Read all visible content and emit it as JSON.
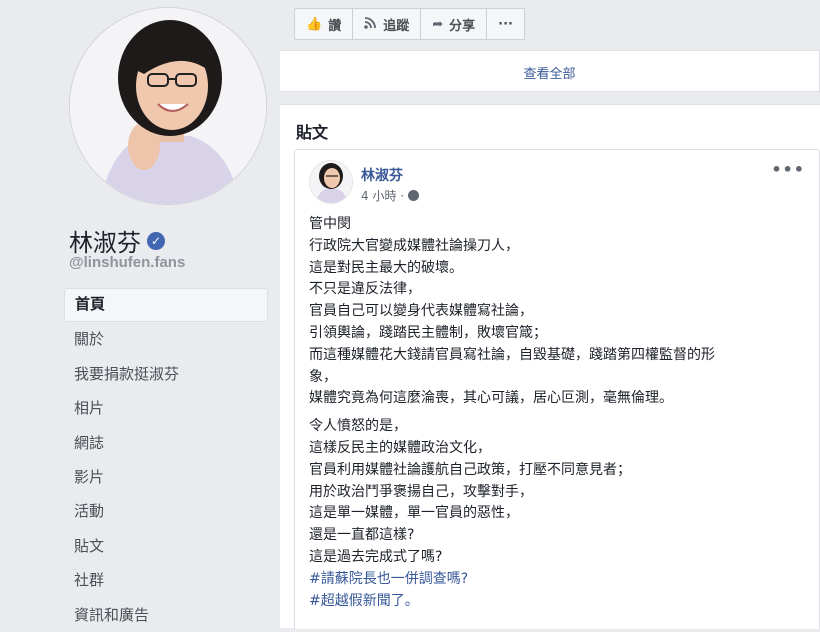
{
  "page": {
    "name": "林淑芬",
    "handle": "@linshufen.fans"
  },
  "nav": [
    {
      "label": "首頁",
      "active": true
    },
    {
      "label": "關於"
    },
    {
      "label": "我要捐款挺淑芬"
    },
    {
      "label": "相片"
    },
    {
      "label": "網誌"
    },
    {
      "label": "影片"
    },
    {
      "label": "活動"
    },
    {
      "label": "貼文"
    },
    {
      "label": "社群"
    },
    {
      "label": "資訊和廣告"
    }
  ],
  "actions": {
    "like": "讚",
    "follow": "追蹤",
    "share": "分享",
    "more": "···"
  },
  "see_all": "查看全部",
  "posts": {
    "title": "貼文",
    "post": {
      "author": "林淑芬",
      "time": "4 小時 ·",
      "paragraph1": [
        "管中閔",
        "行政院大官變成媒體社論操刀人，",
        "這是對民主最大的破壞。",
        "不只是違反法律，",
        "官員自己可以變身代表媒體寫社論，",
        "引領輿論，踐踏民主體制，敗壞官箴；",
        "而這種媒體花大錢請官員寫社論，自毀基礎，踐踏第四權監督的形",
        "象，",
        "媒體究竟為何這麼淪喪，其心可議，居心叵測，毫無倫理。"
      ],
      "paragraph2": [
        "令人憤怒的是，",
        "這樣反民主的媒體政治文化，",
        "官員利用媒體社論護航自己政策，打壓不同意見者；",
        "用於政治鬥爭褒揚自己，攻擊對手，",
        "這是單一媒體，單一官員的惡性，",
        "還是一直都這樣?",
        "這是過去完成式了嗎?"
      ],
      "hashtags": [
        "#請蘇院長也一併調查嗎?",
        "#超越假新聞了。"
      ]
    }
  },
  "colors": {
    "background": "#e9ebee",
    "link": "#385898",
    "verified": "#4267b2"
  }
}
